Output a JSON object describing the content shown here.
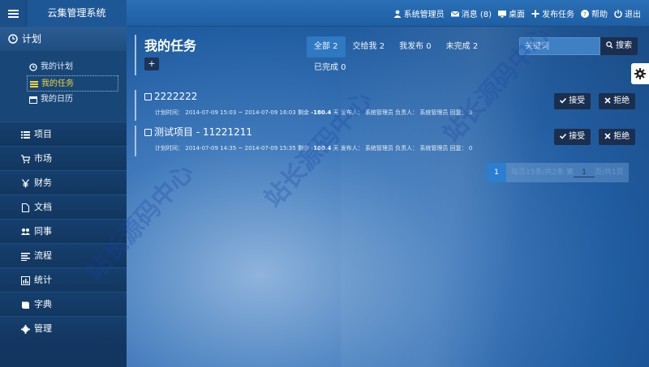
{
  "app": {
    "title": "云集管理系统"
  },
  "topnav": [
    {
      "icon": "user-icon",
      "label": "系统管理员"
    },
    {
      "icon": "envelope-icon",
      "label": "消息 (8)"
    },
    {
      "icon": "desktop-icon",
      "label": "桌面"
    },
    {
      "icon": "plus-icon",
      "label": "发布任务"
    },
    {
      "icon": "help-icon",
      "label": "帮助"
    },
    {
      "icon": "power-icon",
      "label": "退出"
    }
  ],
  "sidebar": {
    "header": {
      "icon": "clock-icon",
      "label": "计划"
    },
    "sub": [
      {
        "icon": "clock-icon",
        "label": "我的计划",
        "active": false
      },
      {
        "icon": "list-icon",
        "label": "我的任务",
        "active": true
      },
      {
        "icon": "calendar-icon",
        "label": "我的日历",
        "active": false
      }
    ],
    "items": [
      {
        "icon": "list-icon",
        "label": "项目"
      },
      {
        "icon": "cart-icon",
        "label": "市场"
      },
      {
        "icon": "yen-icon",
        "label": "财务"
      },
      {
        "icon": "file-icon",
        "label": "文档"
      },
      {
        "icon": "users-icon",
        "label": "同事"
      },
      {
        "icon": "align-icon",
        "label": "流程"
      },
      {
        "icon": "chart-icon",
        "label": "统计"
      },
      {
        "icon": "book-icon",
        "label": "字典"
      },
      {
        "icon": "gear-icon",
        "label": "管理"
      }
    ]
  },
  "main": {
    "title": "我的任务",
    "add_label": "+",
    "tabs": [
      {
        "label": "全部 2",
        "active": true
      },
      {
        "label": "交给我 2",
        "active": false
      },
      {
        "label": "我发布 0",
        "active": false
      },
      {
        "label": "未完成 2",
        "active": false
      },
      {
        "label": "已完成 0",
        "active": false
      }
    ],
    "search": {
      "placeholder": "关键词",
      "button": "搜索"
    },
    "tasks": [
      {
        "title": "2222222",
        "meta_time_label": "计划时间：",
        "meta_time": "2014-07-09 15:03 ~ 2014-07-09 16:03",
        "meta_remain_label": "剩余",
        "meta_remain": "-180.4",
        "meta_unit": "天",
        "meta_publisher_label": "发布人：",
        "meta_publisher": "系统管理员",
        "meta_owner_label": "负责人：",
        "meta_owner": "系统管理员",
        "meta_reply_label": "回复：",
        "meta_reply": "0",
        "accept": "接受",
        "reject": "拒绝"
      },
      {
        "title": "测试项目 - 11221211",
        "meta_time_label": "计划时间：",
        "meta_time": "2014-07-09 14:35 ~ 2014-07-09 15:35",
        "meta_remain_label": "剩余",
        "meta_remain": "-180.4",
        "meta_unit": "天",
        "meta_publisher_label": "发布人：",
        "meta_publisher": "系统管理员",
        "meta_owner_label": "负责人：",
        "meta_owner": "系统管理员",
        "meta_reply_label": "回复：",
        "meta_reply": "0",
        "accept": "接受",
        "reject": "拒绝"
      }
    ],
    "pager": {
      "current": "1",
      "info_prefix": "每页15条/共2条 第",
      "page_value": "1",
      "info_suffix": "页/共1页"
    }
  },
  "watermarks": [
    "站长源码中心",
    "站长源码中心",
    "站长源码中心"
  ],
  "colors": {
    "accent": "#2d7dd0",
    "active_sub": "#f5d13b",
    "button_dark": "#1a2f4f"
  }
}
